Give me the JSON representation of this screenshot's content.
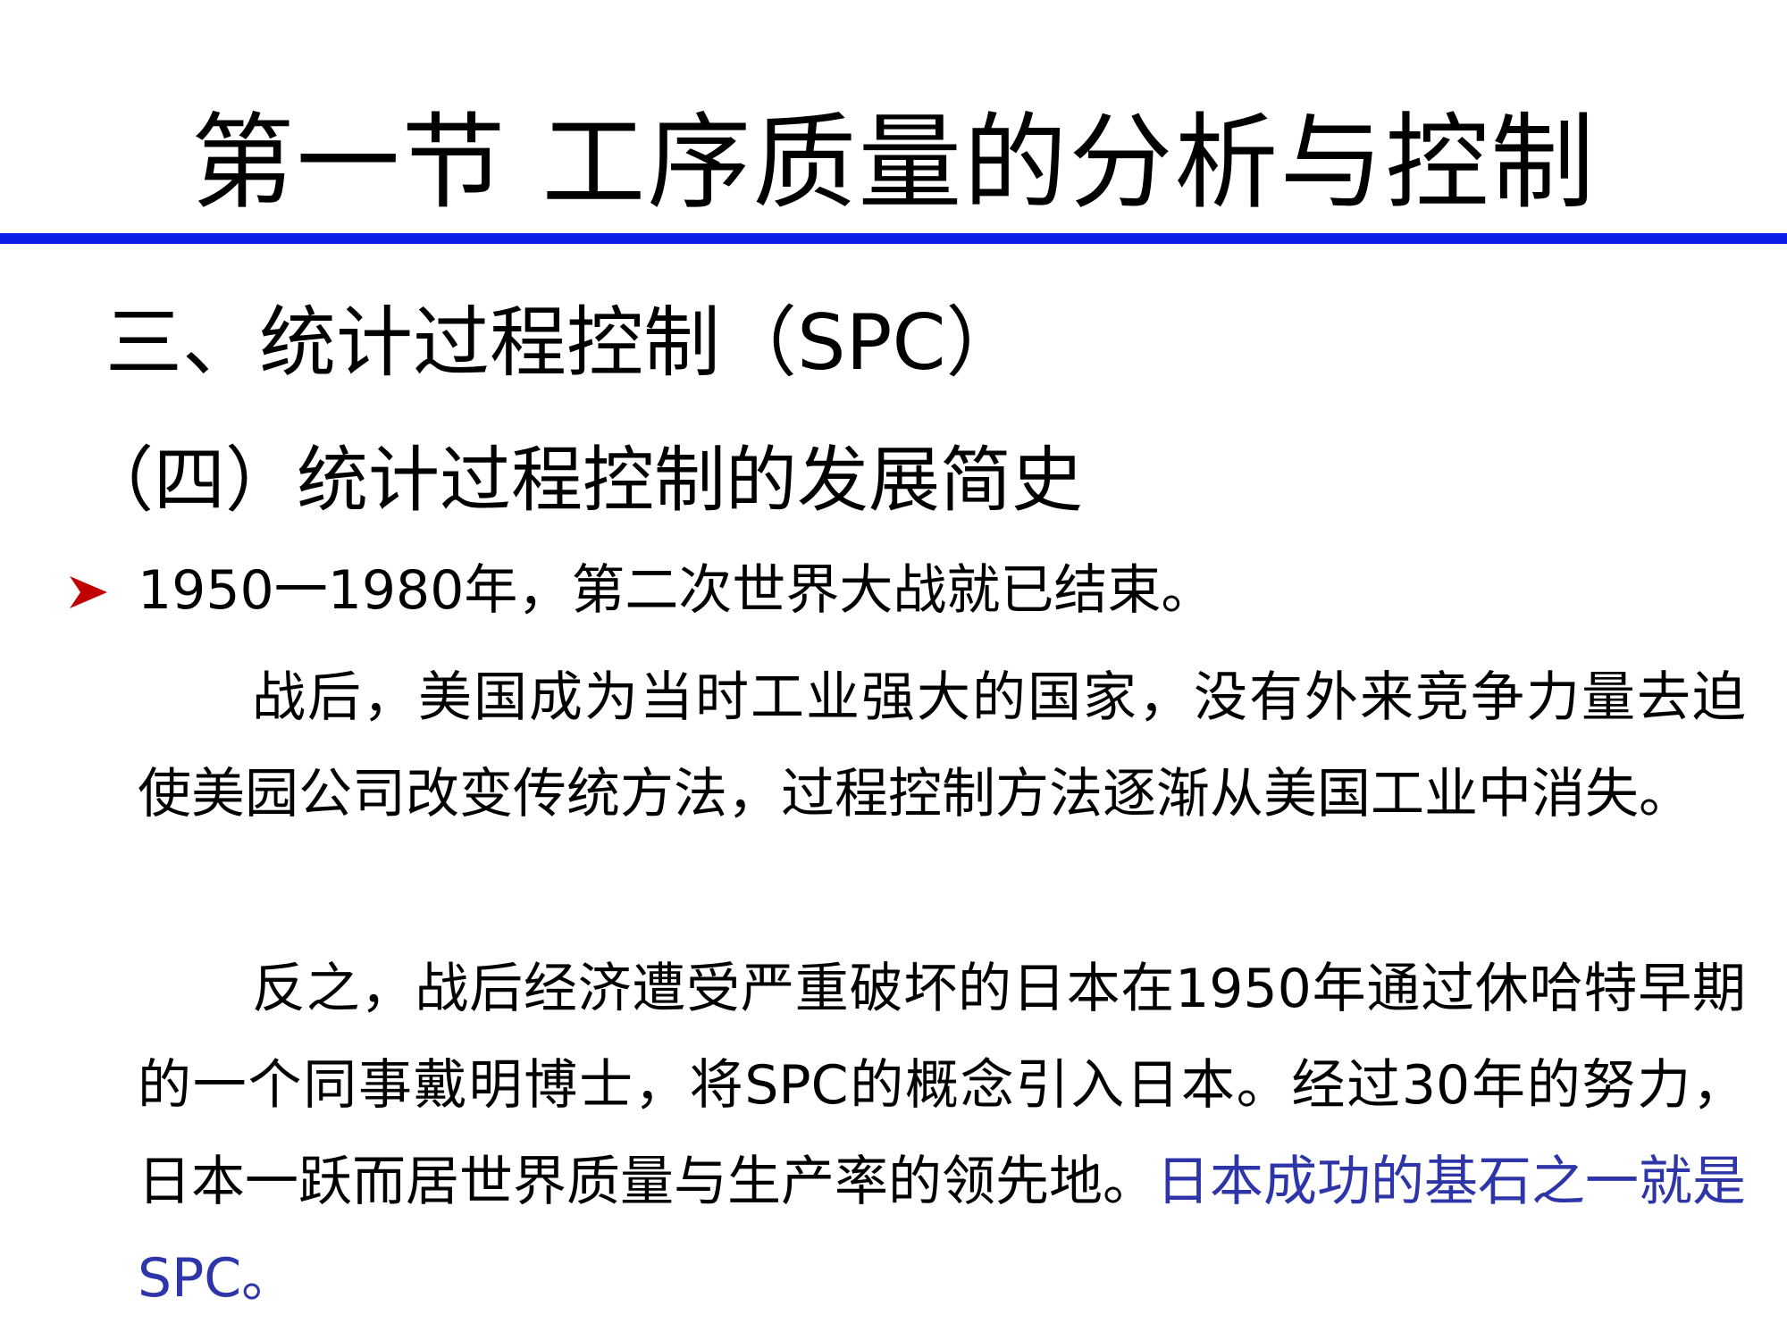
{
  "slide": {
    "title": "第一节 工序质量的分析与控制",
    "title_rule_color": "#0a1ee8",
    "section_heading": "三、统计过程控制（SPC）",
    "subsection_heading": "（四）统计过程控制的发展简史",
    "bullet": {
      "icon": "arrow-bullet-icon",
      "icon_color": "#c00000",
      "text": "1950一1980年，第二次世界大战就已结束。"
    },
    "paragraphs": [
      {
        "text": "战后，美国成为当时工业强大的国家，没有外来竞争力量去迫使美园公司改变传统方法，过程控制方法逐渐从美国工业中消失。"
      },
      {
        "text": "反之，战后经济遭受严重破坏的日本在1950年通过休哈特早期的一个同事戴明博士，将SPC的概念引入日本。经过30年的努力，日本一跃而居世界质量与生产率的领先地。",
        "highlight": "日本成功的基石之一就是SPC。",
        "highlight_color": "#2e35a8"
      }
    ]
  }
}
